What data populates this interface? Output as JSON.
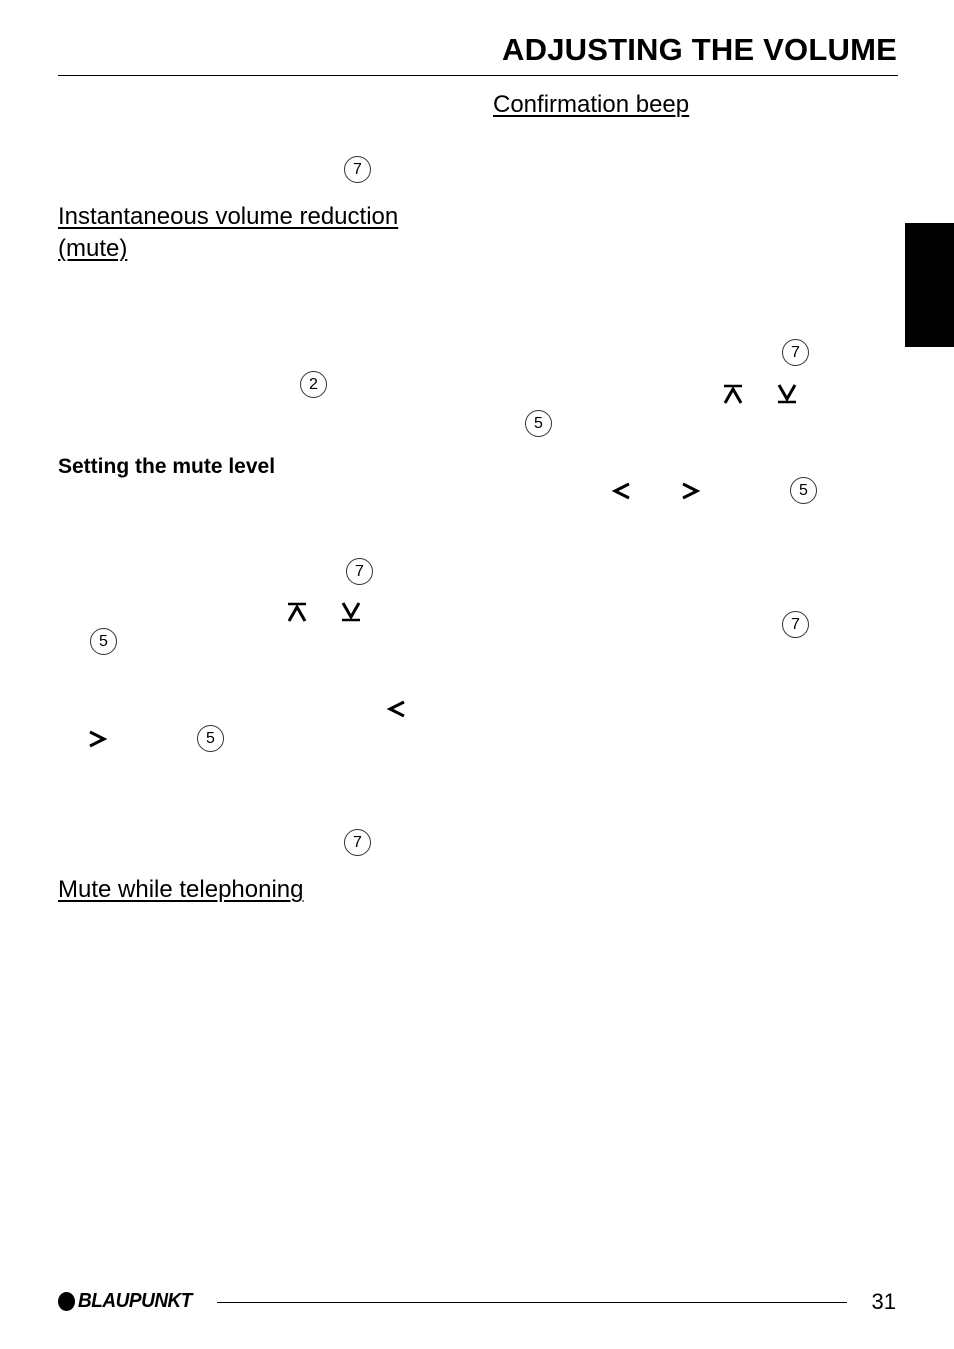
{
  "header": {
    "title": "ADJUSTING THE VOLUME"
  },
  "left_column": {
    "key_ref_1": "7",
    "section_mute_title_line1": "Instantaneous volume reduction",
    "section_mute_title_line2": "(mute)",
    "key_ref_2": "2",
    "subsection_mute_level_title": "Setting the mute level",
    "key_ref_3": "7",
    "up_symbol": "up-arrow-key",
    "down_symbol": "down-arrow-key",
    "key_ref_4": "5",
    "left_symbol": "left-arrow-key",
    "right_symbol": "right-arrow-key",
    "key_ref_5": "5",
    "key_ref_6": "7",
    "section_phone_title": "Mute while telephoning"
  },
  "right_column": {
    "section_beep_title": "Confirmation beep",
    "key_ref_1": "7",
    "key_ref_2": "5",
    "key_ref_3": "5",
    "key_ref_4": "7"
  },
  "footer": {
    "brand": "BLAUPUNKT",
    "page_number": "31"
  }
}
